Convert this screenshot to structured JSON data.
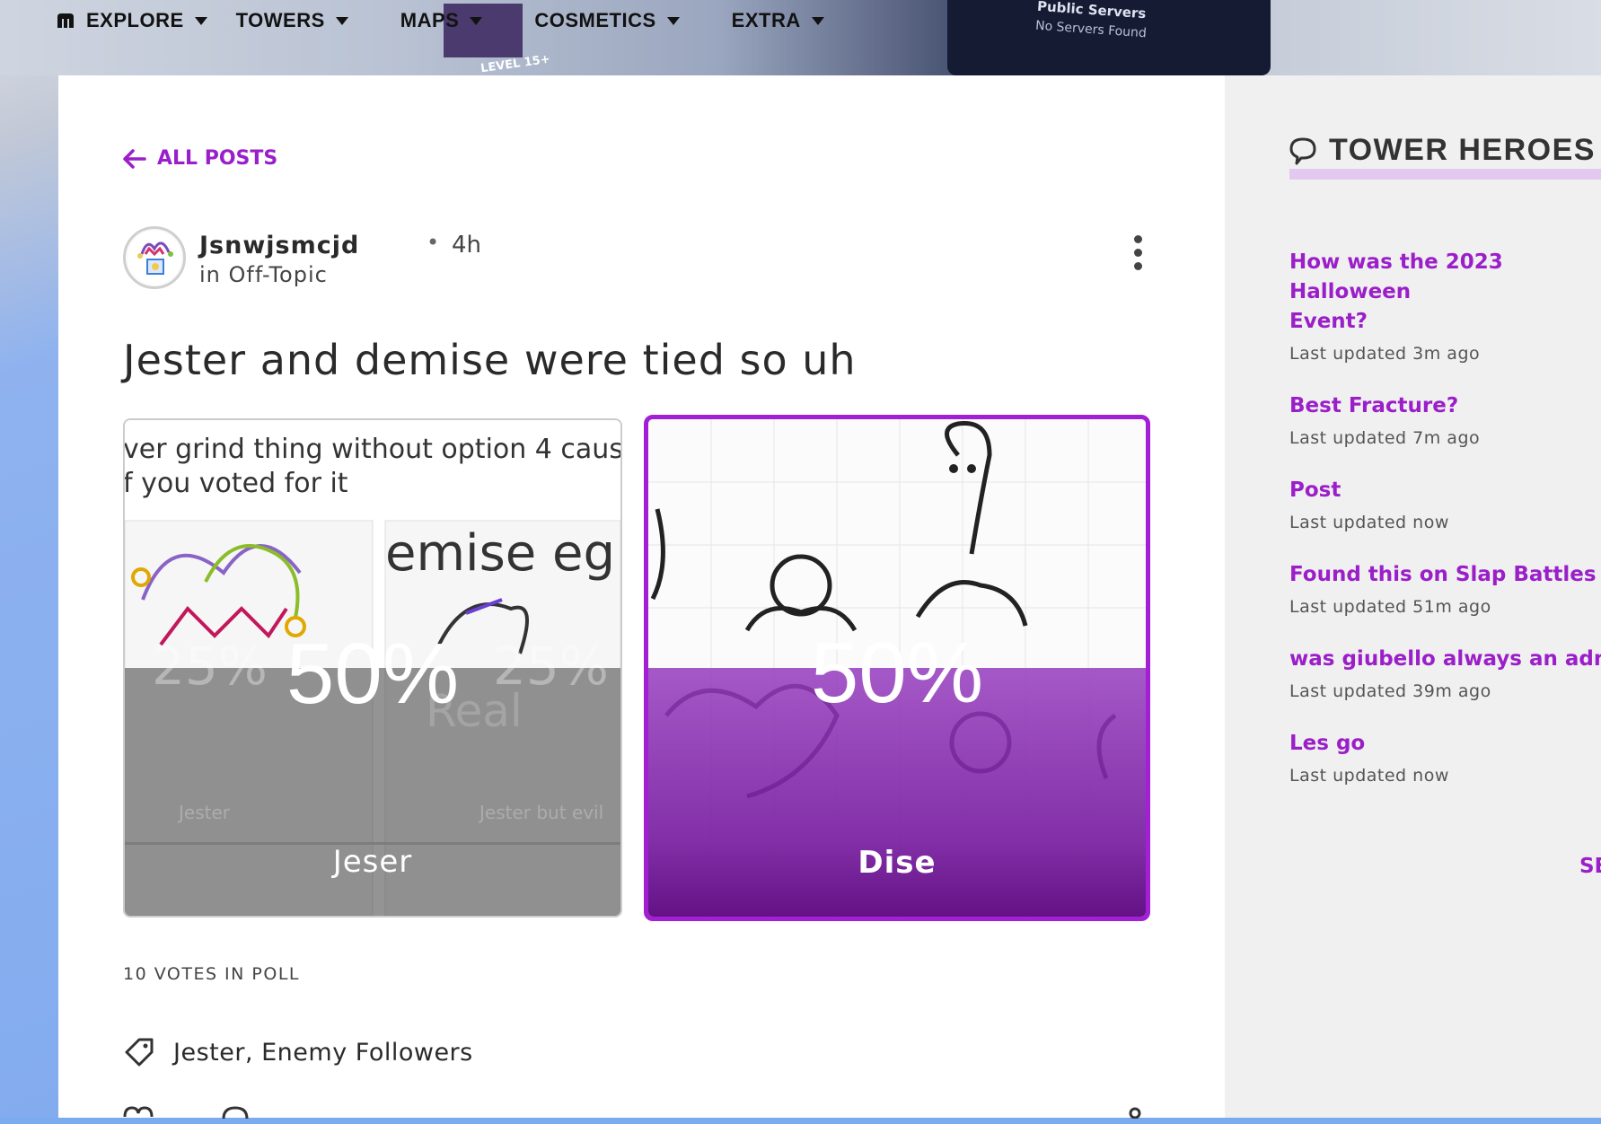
{
  "background": {
    "monitor_title": "Public Servers",
    "monitor_sub": "No Servers Found",
    "level_badge": "LEVEL 15+"
  },
  "nav": {
    "items": [
      {
        "label": "EXPLORE"
      },
      {
        "label": "TOWERS"
      },
      {
        "label": "MAPS"
      },
      {
        "label": "COSMETICS"
      },
      {
        "label": "EXTRA"
      }
    ]
  },
  "post": {
    "back_label": "ALL POSTS",
    "author": "Jsnwjsmcjd",
    "separator": "•",
    "time": "4h",
    "category": "in Off-Topic",
    "title": "Jester and demise were tied so uh",
    "poll": {
      "options": [
        {
          "label": "Jeser",
          "percent": "50%",
          "share": 0.5,
          "image_text_top": "ver grind thing without option 4 caus\nf you voted for it",
          "image_text_mid": "emise eg",
          "image_pct_left": "25%",
          "image_pct_right": "25%",
          "image_real": "Real",
          "image_caption_left": "Jester",
          "image_caption_right": "Jester but evil"
        },
        {
          "label": "Dise",
          "percent": "50%",
          "share": 0.5
        }
      ],
      "votes": "10 VOTES IN POLL"
    },
    "tags": "Jester, Enemy Followers"
  },
  "sidebar": {
    "title": "TOWER HEROES",
    "items": [
      {
        "title": "How was the 2023 Halloween\nEvent?",
        "meta": "Last updated 3m ago"
      },
      {
        "title": "Best Fracture?",
        "meta": "Last updated 7m ago"
      },
      {
        "title": "Post",
        "meta": "Last updated now"
      },
      {
        "title": "Found this on Slap Battles Wi",
        "meta": "Last updated 51m ago"
      },
      {
        "title": "was giubello always an admin",
        "meta": "Last updated 39m ago"
      },
      {
        "title": "Les go",
        "meta": "Last updated now"
      }
    ],
    "more_label": "SE"
  },
  "colors": {
    "accent": "#9b1fc9",
    "selected_border": "#a31fd6",
    "page_bg": "#7aaaf0",
    "sidebar_bg": "#f0f0f0"
  }
}
